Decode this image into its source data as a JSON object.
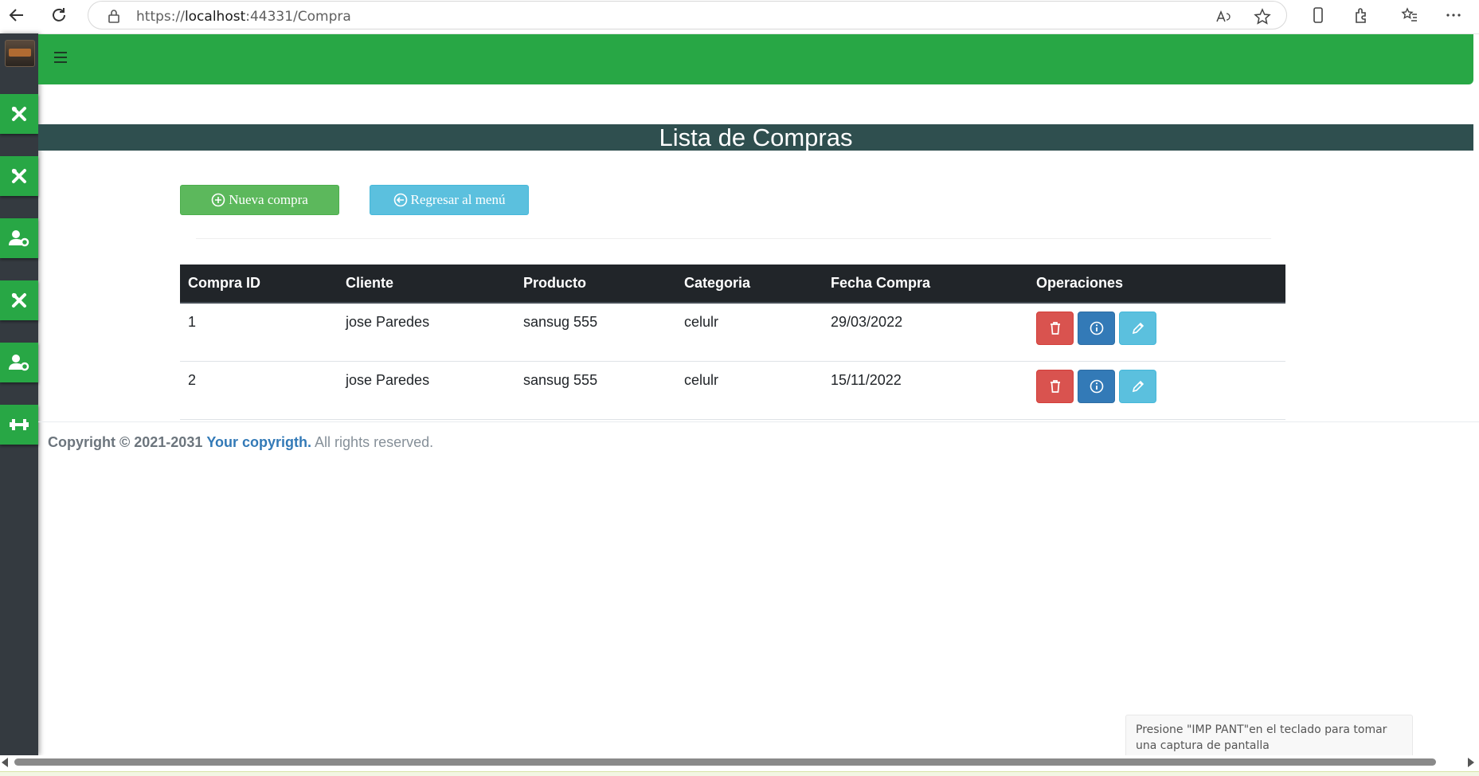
{
  "browser": {
    "url_prefix": "https://",
    "url_host": "localhost",
    "url_rest": ":44331/Compra"
  },
  "page": {
    "title": "Lista de Compras",
    "buttons": {
      "new_label": "Nueva compra",
      "back_label": "Regresar al menú"
    }
  },
  "table": {
    "headers": [
      "Compra ID",
      "Cliente",
      "Producto",
      "Categoria",
      "Fecha Compra",
      "Operaciones"
    ],
    "rows": [
      {
        "id": "1",
        "cliente": "jose Paredes",
        "producto": "sansug 555",
        "categoria": "celulr",
        "fecha": "29/03/2022"
      },
      {
        "id": "2",
        "cliente": "jose Paredes",
        "producto": "sansug 555",
        "categoria": "celulr",
        "fecha": "15/11/2022"
      }
    ]
  },
  "footer": {
    "copyright": "Copyright © 2021-2031",
    "link": "Your copyrigth.",
    "rights": "All rights reserved."
  },
  "toast": {
    "text": "Presione \"IMP PANT\"en el teclado para tomar una captura de pantalla"
  },
  "sidebar": {
    "items": [
      "tools-icon",
      "tools-icon",
      "user-cog-icon",
      "tools-icon",
      "user-cog-icon",
      "dumbbell-icon"
    ]
  },
  "colors": {
    "topbar": "#28a745",
    "title_band": "#2f4f4f",
    "sidebar": "#343a40",
    "btn_new": "#5cb85c",
    "btn_back": "#5bc0de",
    "btn_delete": "#d9534f",
    "btn_info": "#337ab7",
    "btn_edit": "#5bc0de"
  }
}
